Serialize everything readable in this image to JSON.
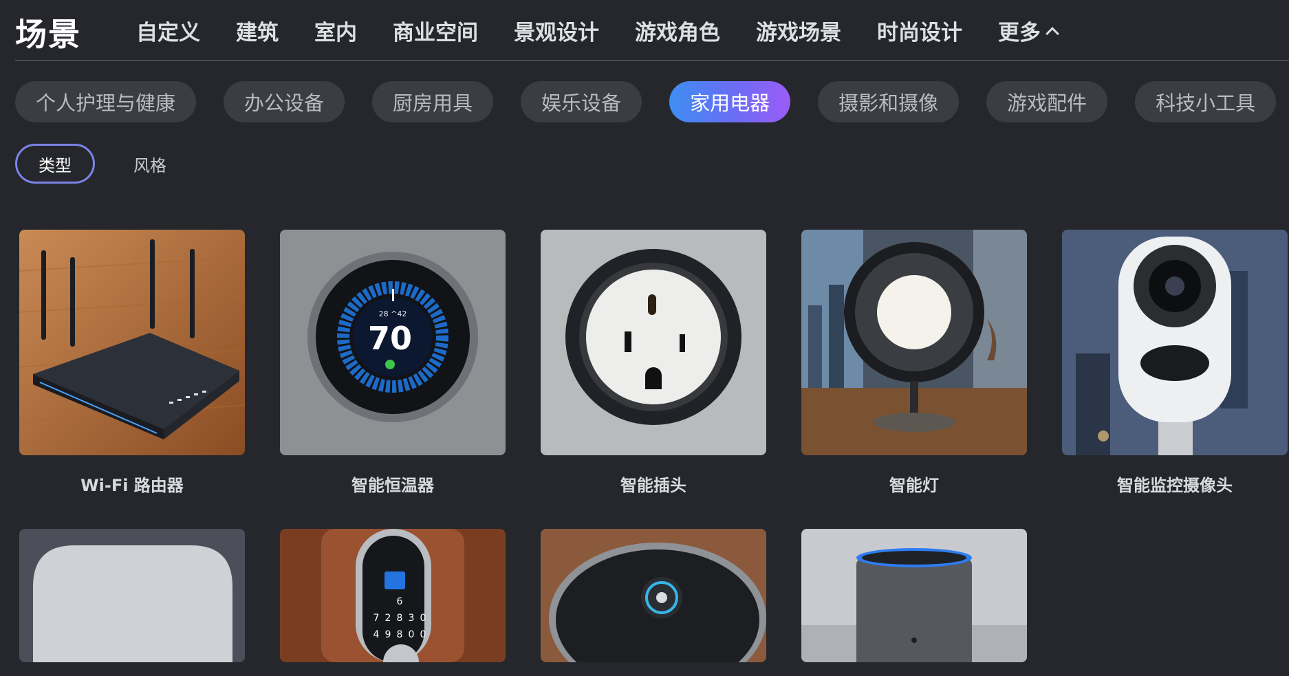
{
  "header": {
    "brand": "场景",
    "nav": [
      "自定义",
      "建筑",
      "室内",
      "商业空间",
      "景观设计",
      "游戏角色",
      "游戏场景",
      "时尚设计"
    ],
    "more": "更多"
  },
  "categories": [
    "个人护理与健康",
    "办公设备",
    "厨房用具",
    "娱乐设备",
    "家用电器",
    "摄影和摄像",
    "游戏配件",
    "科技小工具"
  ],
  "active_category": "家用电器",
  "subtabs": [
    "类型",
    "风格"
  ],
  "cards": [
    {
      "label": "Wi-Fi 路由器",
      "image": "router-image"
    },
    {
      "label": "智能恒温器",
      "image": "thermostat-image",
      "screen": "70",
      "screen_small": "28 ^42"
    },
    {
      "label": "智能插头",
      "image": "smart-plug-image"
    },
    {
      "label": "智能灯",
      "image": "smart-lamp-image"
    },
    {
      "label": "智能监控摄像头",
      "image": "security-camera-image"
    },
    {
      "label": "",
      "image": "smart-hub-image"
    },
    {
      "label": "",
      "image": "smart-lock-image",
      "keys": [
        "6",
        "7",
        "2",
        "8",
        "3",
        "0",
        "4",
        "9",
        "8",
        "0",
        "0"
      ]
    },
    {
      "label": "",
      "image": "robot-vacuum-image"
    },
    {
      "label": "",
      "image": "smart-speaker-image"
    }
  ],
  "colors": {
    "background": "#25272c",
    "pill": "#3a3d44",
    "active_gradient_start": "#3e8ef2",
    "active_gradient_end": "#9c5cf6",
    "subtab_outline": "#7b84e6"
  }
}
